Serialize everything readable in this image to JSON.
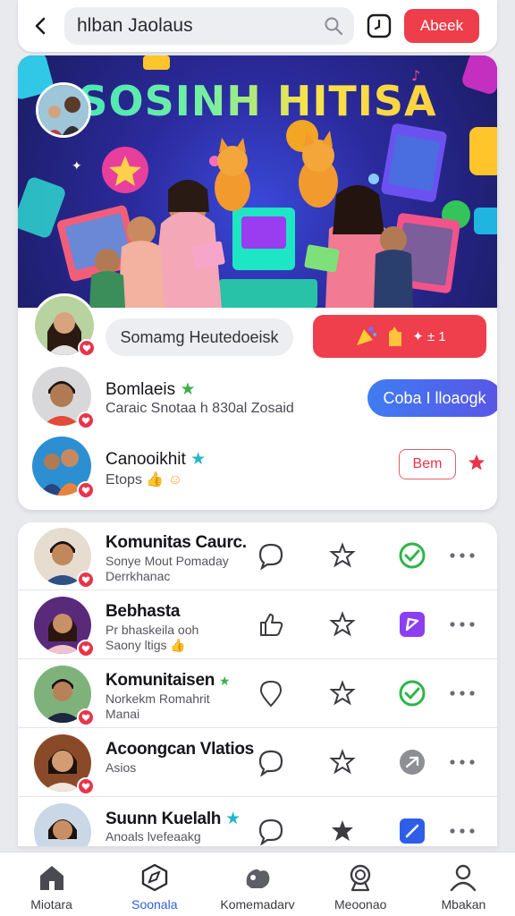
{
  "topbar": {
    "search_value": "hlban Jaolaus",
    "cta_label": "Abeek"
  },
  "banner": {
    "title": "SOSINH HITISA"
  },
  "community": {
    "info_pill": "Somamg Heutedoeisk",
    "join_label": "✦ ± 1",
    "members": [
      {
        "name": "Bomlaeis",
        "sub": "Caraic Snotaa h 830al Zosaid",
        "action": "Coba I lloaogk"
      },
      {
        "name": "Canooikhit",
        "sub": "Etops",
        "action": "Bem"
      }
    ]
  },
  "list": [
    {
      "title": "Komunitas Caurc.",
      "sub1": "Sonye  Mout Pomaday",
      "sub2": "Derrkhanac",
      "status": "check",
      "status_color": "#2fb54a"
    },
    {
      "title": "Bebhasta",
      "sub1": "Pr bhaskeila ooh",
      "sub2": "Saony ltigs",
      "status": "purple",
      "status_color": "#8b3ff0"
    },
    {
      "title": "Komunitaisen",
      "sub1": "Norkekm Romahrit",
      "sub2": "Manai",
      "status": "check",
      "status_color": "#2fb54a"
    },
    {
      "title": "Acoongcan Vlatios",
      "sub1": "Asios",
      "sub2": "",
      "status": "grey",
      "status_color": "#8e8f94"
    },
    {
      "title": "Suunn Kuelalh",
      "sub1": "Anoals lvefeaakg",
      "sub2": "",
      "status": "blue",
      "status_color": "#2e5ee8"
    }
  ],
  "nav": [
    {
      "label": "Miotara",
      "icon": "home-icon"
    },
    {
      "label": "Soonala",
      "icon": "compass-icon"
    },
    {
      "label": "Komemadarv",
      "icon": "community-icon"
    },
    {
      "label": "Meoonao",
      "icon": "badge-icon"
    },
    {
      "label": "Mbakan",
      "icon": "profile-icon"
    }
  ],
  "colors": {
    "accent_red": "#ee3d4b",
    "accent_blue": "#3f7cf2",
    "active_nav": "#2d5fd8"
  }
}
